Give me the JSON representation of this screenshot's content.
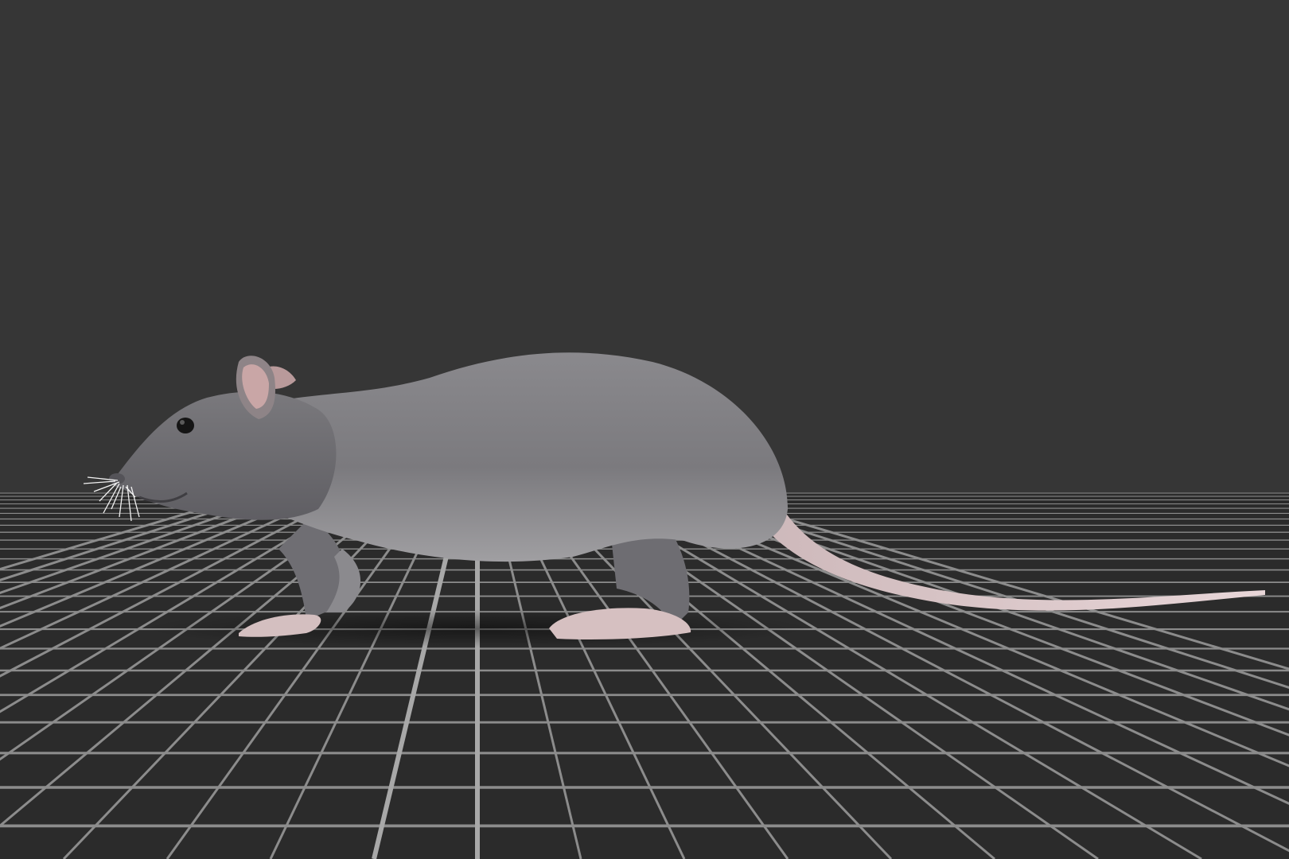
{
  "scene": {
    "subject": "rat",
    "colors": {
      "background": "#363636",
      "floor": "#2c2c2c",
      "grid_line": "#8c8c8c",
      "grid_line_bright": "#a8a8a8",
      "fur": "#7d7d80",
      "fur_light": "#9a999c",
      "fur_dark": "#5e5e62",
      "skin_pink": "#d9c3c3",
      "ear_inner": "#c9a6a6",
      "eye": "#151515",
      "whisker": "#f2f2f2"
    }
  }
}
